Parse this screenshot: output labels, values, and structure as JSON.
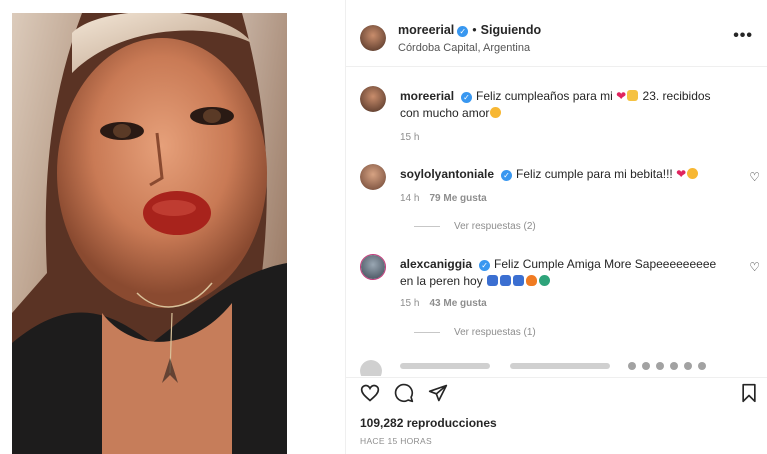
{
  "header": {
    "username": "moreerial",
    "separator": "•",
    "follow_state": "Siguiendo",
    "location": "Córdoba Capital, Argentina",
    "more_label": "•••"
  },
  "comments": [
    {
      "username": "moreerial",
      "text_before": "Feliz cumpleaños para mi",
      "text_mid": "23. recibidos con mucho amor",
      "time": "15 h"
    },
    {
      "username": "soylolyantoniale",
      "text_before": "Feliz cumple para mi bebita!!!",
      "time": "14 h",
      "likes": "79 Me gusta",
      "replies": "Ver respuestas (2)"
    },
    {
      "username": "alexcaniggia",
      "text_before": "Feliz Cumple Amiga More Sapeeeeeeeee en la peren hoy",
      "time": "15 h",
      "likes": "43 Me gusta",
      "replies": "Ver respuestas (1)"
    }
  ],
  "footer": {
    "views": "109,282 reproducciones",
    "time_ago": "HACE 15 HORAS"
  },
  "icons": {
    "like": "heart-icon",
    "comment": "comment-icon",
    "share": "share-icon",
    "save": "bookmark-icon"
  },
  "colors": {
    "verified": "#3897f0",
    "secondary_text": "#8e8e8e",
    "primary_text": "#262626"
  }
}
